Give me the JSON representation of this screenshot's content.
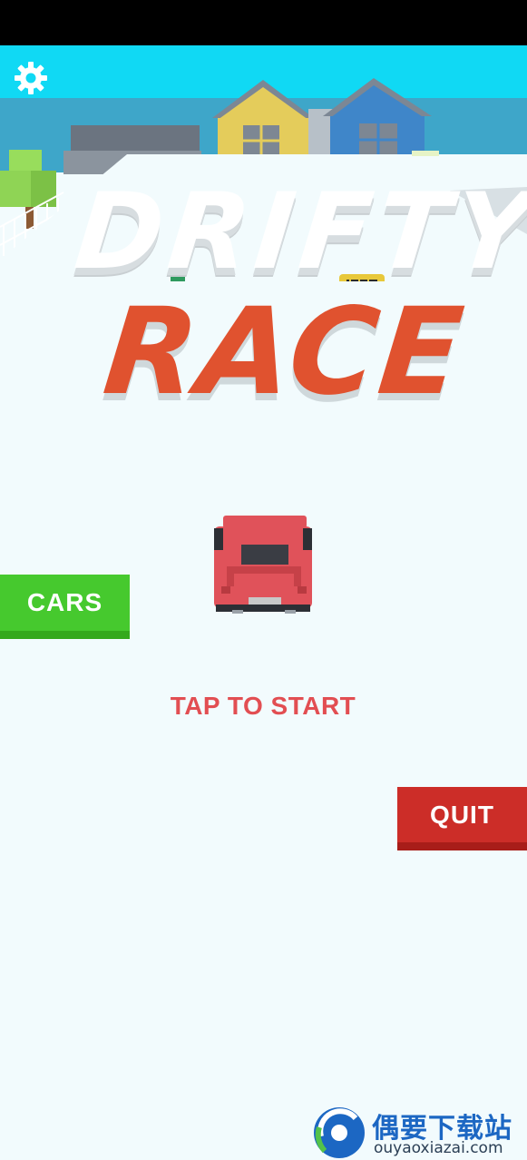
{
  "title": {
    "line1": "DRIFTY",
    "line2": "RACE"
  },
  "buttons": {
    "cars": "CARS",
    "quit": "QUIT"
  },
  "prompt": {
    "tap_to_start": "TAP TO START"
  },
  "icons": {
    "settings": "gear-icon"
  },
  "watermark": {
    "name": "偶要下载站",
    "url": "ouyaoxiazai.com"
  },
  "colors": {
    "sky": "#10d9f4",
    "road": "#f2fbfd",
    "race_title": "#e0522f",
    "cars_button": "#46c92e",
    "quit_button": "#cc2d28",
    "prompt_text": "#e24e52",
    "player_car": "#e0525a"
  }
}
